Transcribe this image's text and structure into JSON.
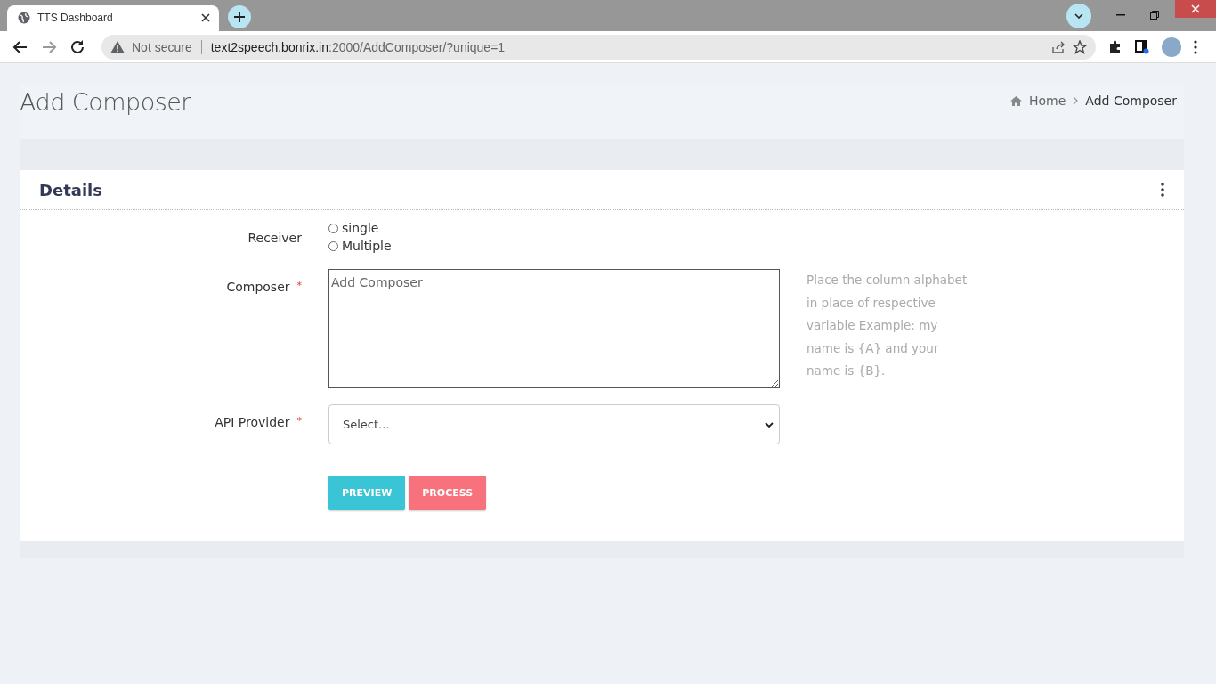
{
  "browser": {
    "tab_title": "TTS Dashboard",
    "security": "Not secure",
    "url": {
      "host": "text2speech.bonrix.in",
      "path": ":2000/AddComposer/?unique=1"
    }
  },
  "page_title": "Add Composer",
  "breadcrumb": [
    {
      "label": "Home",
      "kind": "link"
    },
    {
      "label": "Add Composer",
      "kind": "current"
    }
  ],
  "card": {
    "title": "Details",
    "receiver": {
      "label": "Receiver",
      "options": [
        {
          "label": "single",
          "selected": false
        },
        {
          "label": "Multiple",
          "selected": false
        }
      ]
    },
    "composer": {
      "label": "Composer",
      "required_mark": "*",
      "placeholder": "Add Composer",
      "help": "Place the column alphabet in place of respective variable Example: my name is {A} and your name is {B}."
    },
    "api_provider": {
      "label": "API Provider",
      "required_mark": "*",
      "value": "Select..."
    },
    "buttons": [
      {
        "label": "PREVIEW",
        "kind": "info"
      },
      {
        "label": "PROCESS",
        "kind": "danger"
      }
    ]
  }
}
